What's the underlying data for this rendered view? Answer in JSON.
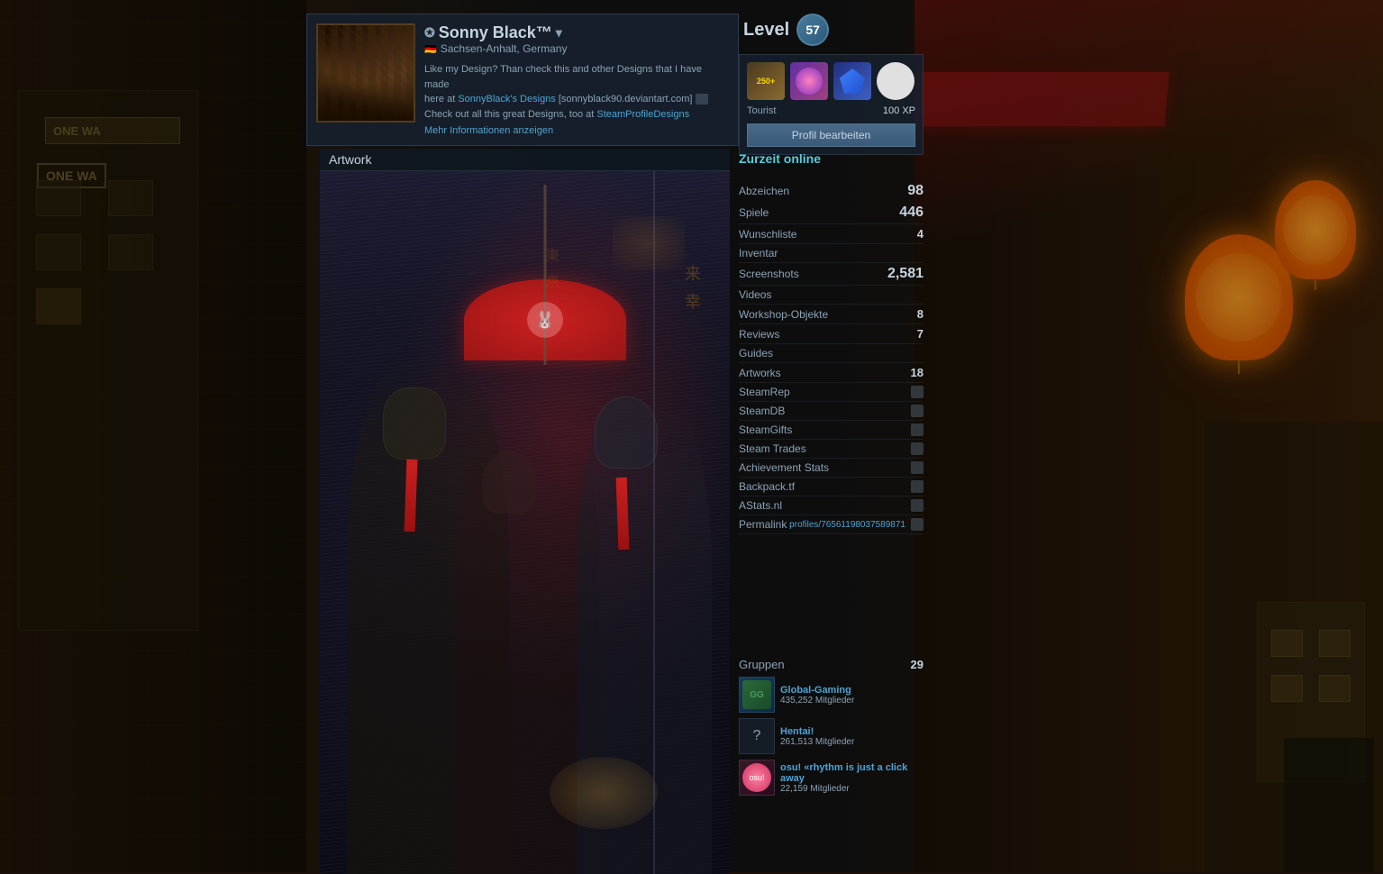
{
  "background": {
    "leftColor": "#2a1c08",
    "rightColor": "#3a2008"
  },
  "profile": {
    "name": "Sonny Black™",
    "name_prefix": "✪",
    "location": "Sachsen-Anhalt, Germany",
    "desc_line1": "Like my Design? Than check this and other Designs that I have made",
    "desc_line2": "here at",
    "sonnyblack_link": "SonnyBlack's Designs",
    "sonnyblack_url": "[sonnyblack90.deviantart.com]",
    "desc_line3": "Check out all this great Designs, too at",
    "steamprofile_link": "SteamProfileDesigns",
    "more_info": "Mehr Informationen anzeigen",
    "dropdown_icon": "▾"
  },
  "level": {
    "label": "Level",
    "value": "57"
  },
  "badge": {
    "name": "Tourist",
    "xp": "100 XP"
  },
  "buttons": {
    "edit_profile": "Profil bearbeiten"
  },
  "online_status": "Zurzeit online",
  "stats": {
    "abzeichen_label": "Abzeichen",
    "abzeichen_value": "98",
    "spiele_label": "Spiele",
    "spiele_value": "446",
    "wunschliste_label": "Wunschliste",
    "wunschliste_value": "4",
    "inventar_label": "Inventar",
    "inventar_value": "",
    "screenshots_label": "Screenshots",
    "screenshots_value": "2,581",
    "videos_label": "Videos",
    "videos_value": "",
    "workshop_label": "Workshop-Objekte",
    "workshop_value": "8",
    "reviews_label": "Reviews",
    "reviews_value": "7",
    "guides_label": "Guides",
    "guides_value": "",
    "artworks_label": "Artworks",
    "artworks_value": "18",
    "steamrep_label": "SteamRep",
    "steamdb_label": "SteamDB",
    "steamgifts_label": "SteamGifts",
    "steamtrades_label": "Steam Trades",
    "achievement_stats_label": "Achievement Stats",
    "backpack_label": "Backpack.tf",
    "astats_label": "AStats.nl",
    "permalink_label": "Permalink",
    "permalink_value": "profiles/76561198037589871"
  },
  "artwork": {
    "title": "Artwork"
  },
  "groups": {
    "label": "Gruppen",
    "count": "29",
    "items": [
      {
        "name": "Global-Gaming",
        "members": "435,252 Mitglieder"
      },
      {
        "name": "Hentai!",
        "members": "261,513 Mitglieder"
      },
      {
        "name": "osu! «rhythm is just a click away",
        "members": "22,159 Mitglieder"
      }
    ]
  }
}
